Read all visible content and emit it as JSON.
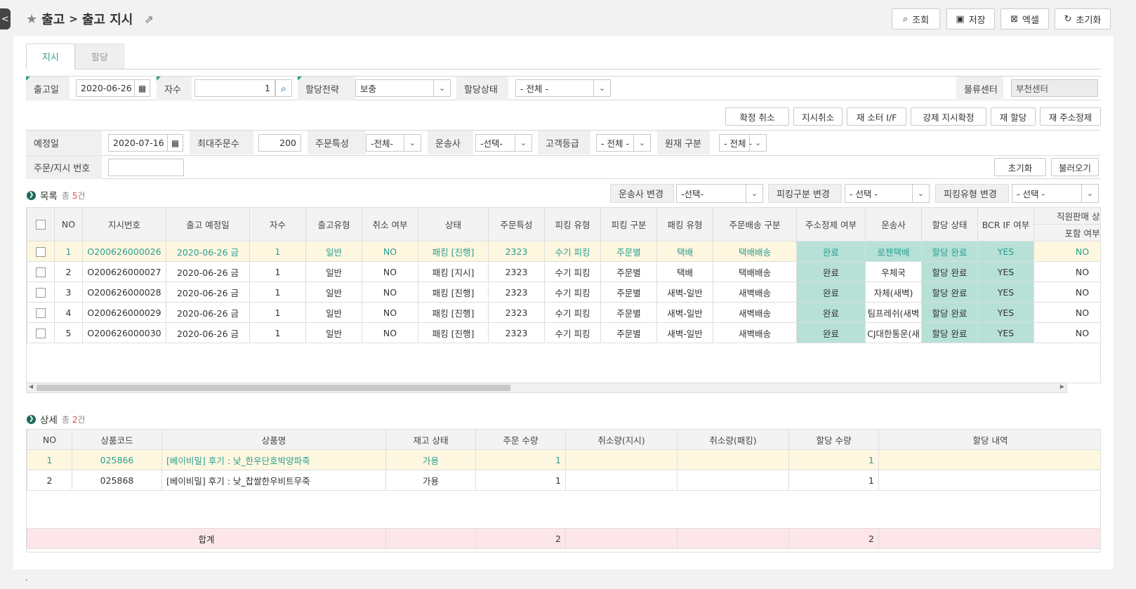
{
  "breadcrumb": {
    "parent": "출고",
    "sep": ">",
    "current": "출고 지시"
  },
  "toolbar": {
    "search": "조회",
    "save": "저장",
    "excel": "엑셀",
    "reset": "초기화"
  },
  "tabs": [
    "지시",
    "할당"
  ],
  "filters": {
    "ship_date_label": "출고일",
    "ship_date": "2020-06-26",
    "round_label": "자수",
    "round_value": "1",
    "strategy_label": "할당전략",
    "strategy_value": "보충",
    "alloc_status_label": "할당상태",
    "alloc_status_value": "- 전체 -",
    "center_label": "물류센터",
    "center_value": "부천센터",
    "plan_date_label": "예정일",
    "plan_date": "2020-07-16",
    "max_orders_label": "최대주문수",
    "max_orders": "200",
    "order_attr_label": "주문특성",
    "order_attr_value": "-전체-",
    "carrier_label": "운송사",
    "carrier_value": "-선택-",
    "grade_label": "고객등급",
    "grade_value": "- 전체 -",
    "material_label": "원재 구분",
    "material_value": "- 전체 -",
    "order_no_label": "주문/지시 번호",
    "order_no_value": ""
  },
  "actions": [
    "확정 취소",
    "지시취소",
    "재 소터 I/F",
    "강제 지시확정",
    "재 할당",
    "재 주소정제"
  ],
  "actions2": {
    "reset": "초기화",
    "load": "불러오기"
  },
  "list": {
    "title": "목록",
    "count_prefix": "총",
    "count": "5",
    "count_suffix": "건",
    "carrier_change_label": "운송사 변경",
    "carrier_change_value": "-선택-",
    "pick_div_label": "피킹구분 변경",
    "pick_div_value": "- 선택 -",
    "pick_type_label": "피킹유형 변경",
    "pick_type_value": "- 선택 -",
    "headers": [
      "NO",
      "지시번호",
      "출고 예정일",
      "자수",
      "출고유형",
      "취소 여부",
      "상태",
      "주문특성",
      "피킹 유형",
      "피킹 구분",
      "패킹 유형",
      "주문배송 구분",
      "주소정제 여부",
      "운송사",
      "할당 상태",
      "BCR IF 여부",
      "직원판매 상품",
      "포함 여부"
    ],
    "rows": [
      [
        "1",
        "O200626000026",
        "2020-06-26 금",
        "1",
        "일반",
        "NO",
        "패킹 [진행]",
        "2323",
        "수기 피킹",
        "주문별",
        "택배",
        "택배배송",
        "완료",
        "로젠택배",
        "할당 완료",
        "YES",
        "NO"
      ],
      [
        "2",
        "O200626000027",
        "2020-06-26 금",
        "1",
        "일반",
        "NO",
        "패킹 [지시]",
        "2323",
        "수기 피킹",
        "주문별",
        "택배",
        "택배배송",
        "완료",
        "우체국",
        "할당 완료",
        "YES",
        "NO"
      ],
      [
        "3",
        "O200626000028",
        "2020-06-26 금",
        "1",
        "일반",
        "NO",
        "패킹 [진행]",
        "2323",
        "수기 피킹",
        "주문별",
        "새벽-일반",
        "새벽배송",
        "완료",
        "자체(새벽)",
        "할당 완료",
        "YES",
        "NO"
      ],
      [
        "4",
        "O200626000029",
        "2020-06-26 금",
        "1",
        "일반",
        "NO",
        "패킹 [진행]",
        "2323",
        "수기 피킹",
        "주문별",
        "새벽-일반",
        "새벽배송",
        "완료",
        "팀프레쉬(새벽",
        "할당 완료",
        "YES",
        "NO"
      ],
      [
        "5",
        "O200626000030",
        "2020-06-26 금",
        "1",
        "일반",
        "NO",
        "패킹 [진행]",
        "2323",
        "수기 피킹",
        "주문별",
        "새벽-일반",
        "새벽배송",
        "완료",
        "CJ대한통운(새",
        "할당 완료",
        "YES",
        "NO"
      ]
    ]
  },
  "detail": {
    "title": "상세",
    "count_prefix": "총",
    "count": "2",
    "count_suffix": "건",
    "headers": [
      "NO",
      "상품코드",
      "상품명",
      "재고 상태",
      "주문 수량",
      "취소량(지시)",
      "취소량(패킹)",
      "할당 수량",
      "할당 내역"
    ],
    "rows": [
      [
        "1",
        "025866",
        "[베이비밀] 후기 : 낮_한우단호박양파죽",
        "가용",
        "1",
        "",
        "",
        "1",
        ""
      ],
      [
        "2",
        "025868",
        "[베이비밀] 후기 : 낮_찹쌀한우비트무죽",
        "가용",
        "1",
        "",
        "",
        "1",
        ""
      ]
    ],
    "sum_label": "합계",
    "sum_order_qty": "2",
    "sum_alloc_qty": "2"
  },
  "footer_mark": "."
}
